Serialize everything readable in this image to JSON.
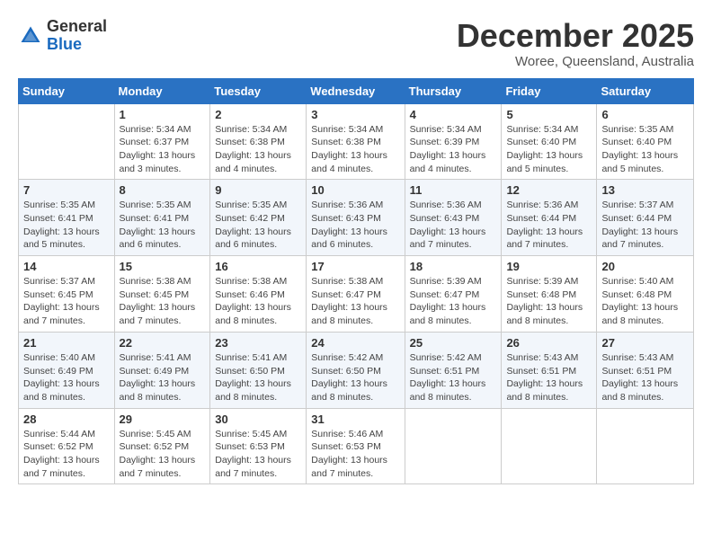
{
  "header": {
    "logo": {
      "general": "General",
      "blue": "Blue"
    },
    "title": "December 2025",
    "location": "Woree, Queensland, Australia"
  },
  "calendar": {
    "days_of_week": [
      "Sunday",
      "Monday",
      "Tuesday",
      "Wednesday",
      "Thursday",
      "Friday",
      "Saturday"
    ],
    "weeks": [
      [
        {
          "day": "",
          "detail": ""
        },
        {
          "day": "1",
          "detail": "Sunrise: 5:34 AM\nSunset: 6:37 PM\nDaylight: 13 hours\nand 3 minutes."
        },
        {
          "day": "2",
          "detail": "Sunrise: 5:34 AM\nSunset: 6:38 PM\nDaylight: 13 hours\nand 4 minutes."
        },
        {
          "day": "3",
          "detail": "Sunrise: 5:34 AM\nSunset: 6:38 PM\nDaylight: 13 hours\nand 4 minutes."
        },
        {
          "day": "4",
          "detail": "Sunrise: 5:34 AM\nSunset: 6:39 PM\nDaylight: 13 hours\nand 4 minutes."
        },
        {
          "day": "5",
          "detail": "Sunrise: 5:34 AM\nSunset: 6:40 PM\nDaylight: 13 hours\nand 5 minutes."
        },
        {
          "day": "6",
          "detail": "Sunrise: 5:35 AM\nSunset: 6:40 PM\nDaylight: 13 hours\nand 5 minutes."
        }
      ],
      [
        {
          "day": "7",
          "detail": "Sunrise: 5:35 AM\nSunset: 6:41 PM\nDaylight: 13 hours\nand 5 minutes."
        },
        {
          "day": "8",
          "detail": "Sunrise: 5:35 AM\nSunset: 6:41 PM\nDaylight: 13 hours\nand 6 minutes."
        },
        {
          "day": "9",
          "detail": "Sunrise: 5:35 AM\nSunset: 6:42 PM\nDaylight: 13 hours\nand 6 minutes."
        },
        {
          "day": "10",
          "detail": "Sunrise: 5:36 AM\nSunset: 6:43 PM\nDaylight: 13 hours\nand 6 minutes."
        },
        {
          "day": "11",
          "detail": "Sunrise: 5:36 AM\nSunset: 6:43 PM\nDaylight: 13 hours\nand 7 minutes."
        },
        {
          "day": "12",
          "detail": "Sunrise: 5:36 AM\nSunset: 6:44 PM\nDaylight: 13 hours\nand 7 minutes."
        },
        {
          "day": "13",
          "detail": "Sunrise: 5:37 AM\nSunset: 6:44 PM\nDaylight: 13 hours\nand 7 minutes."
        }
      ],
      [
        {
          "day": "14",
          "detail": "Sunrise: 5:37 AM\nSunset: 6:45 PM\nDaylight: 13 hours\nand 7 minutes."
        },
        {
          "day": "15",
          "detail": "Sunrise: 5:38 AM\nSunset: 6:45 PM\nDaylight: 13 hours\nand 7 minutes."
        },
        {
          "day": "16",
          "detail": "Sunrise: 5:38 AM\nSunset: 6:46 PM\nDaylight: 13 hours\nand 8 minutes."
        },
        {
          "day": "17",
          "detail": "Sunrise: 5:38 AM\nSunset: 6:47 PM\nDaylight: 13 hours\nand 8 minutes."
        },
        {
          "day": "18",
          "detail": "Sunrise: 5:39 AM\nSunset: 6:47 PM\nDaylight: 13 hours\nand 8 minutes."
        },
        {
          "day": "19",
          "detail": "Sunrise: 5:39 AM\nSunset: 6:48 PM\nDaylight: 13 hours\nand 8 minutes."
        },
        {
          "day": "20",
          "detail": "Sunrise: 5:40 AM\nSunset: 6:48 PM\nDaylight: 13 hours\nand 8 minutes."
        }
      ],
      [
        {
          "day": "21",
          "detail": "Sunrise: 5:40 AM\nSunset: 6:49 PM\nDaylight: 13 hours\nand 8 minutes."
        },
        {
          "day": "22",
          "detail": "Sunrise: 5:41 AM\nSunset: 6:49 PM\nDaylight: 13 hours\nand 8 minutes."
        },
        {
          "day": "23",
          "detail": "Sunrise: 5:41 AM\nSunset: 6:50 PM\nDaylight: 13 hours\nand 8 minutes."
        },
        {
          "day": "24",
          "detail": "Sunrise: 5:42 AM\nSunset: 6:50 PM\nDaylight: 13 hours\nand 8 minutes."
        },
        {
          "day": "25",
          "detail": "Sunrise: 5:42 AM\nSunset: 6:51 PM\nDaylight: 13 hours\nand 8 minutes."
        },
        {
          "day": "26",
          "detail": "Sunrise: 5:43 AM\nSunset: 6:51 PM\nDaylight: 13 hours\nand 8 minutes."
        },
        {
          "day": "27",
          "detail": "Sunrise: 5:43 AM\nSunset: 6:51 PM\nDaylight: 13 hours\nand 8 minutes."
        }
      ],
      [
        {
          "day": "28",
          "detail": "Sunrise: 5:44 AM\nSunset: 6:52 PM\nDaylight: 13 hours\nand 7 minutes."
        },
        {
          "day": "29",
          "detail": "Sunrise: 5:45 AM\nSunset: 6:52 PM\nDaylight: 13 hours\nand 7 minutes."
        },
        {
          "day": "30",
          "detail": "Sunrise: 5:45 AM\nSunset: 6:53 PM\nDaylight: 13 hours\nand 7 minutes."
        },
        {
          "day": "31",
          "detail": "Sunrise: 5:46 AM\nSunset: 6:53 PM\nDaylight: 13 hours\nand 7 minutes."
        },
        {
          "day": "",
          "detail": ""
        },
        {
          "day": "",
          "detail": ""
        },
        {
          "day": "",
          "detail": ""
        }
      ]
    ]
  }
}
